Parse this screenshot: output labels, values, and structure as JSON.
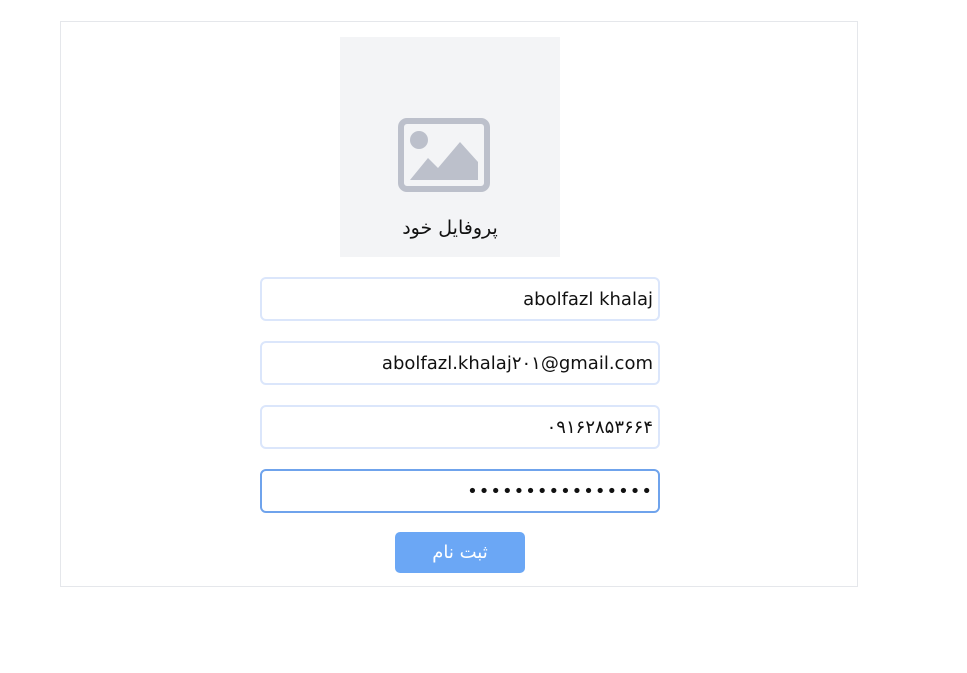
{
  "profile": {
    "label": "پروفایل خود",
    "image_icon": "image-placeholder-icon"
  },
  "form": {
    "name_value": "abolfazl khalaj",
    "email_value": "abolfazl.khalaj۲۰۱@gmail.com",
    "phone_value": "۰۹۱۶۲۸۵۳۶۶۴",
    "password_value": "••••••••••••••••"
  },
  "submit": {
    "label": "ثبت نام"
  },
  "colors": {
    "border": "#dbe6fb",
    "focus_border": "#6fa3ec",
    "button": "#6ba7f5",
    "avatar_bg": "#f3f4f6",
    "icon": "#bcc0cb"
  }
}
